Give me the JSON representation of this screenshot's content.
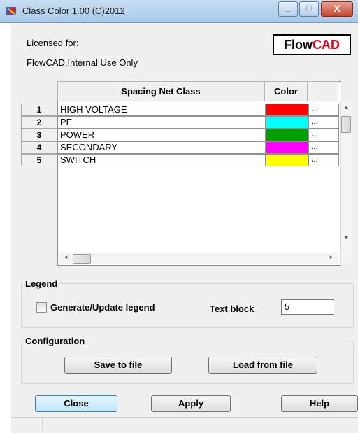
{
  "window": {
    "title": "Class Color 1.00 (C)2012"
  },
  "license": {
    "label": "Licensed for:",
    "holder": "FlowCAD,Internal Use Only"
  },
  "logo": {
    "part1": "Flow",
    "part2": "CAD",
    "color_part2": "#e8001c"
  },
  "grid": {
    "columns": [
      "Spacing Net Class",
      "Color",
      ""
    ],
    "rows": [
      {
        "num": "1",
        "name": "HIGH VOLTAGE",
        "color": "#ff0000",
        "picker": "..."
      },
      {
        "num": "2",
        "name": "PE",
        "color": "#00ffff",
        "picker": "..."
      },
      {
        "num": "3",
        "name": "POWER",
        "color": "#00a000",
        "picker": "..."
      },
      {
        "num": "4",
        "name": "SECONDARY",
        "color": "#ff00ff",
        "picker": "..."
      },
      {
        "num": "5",
        "name": "SWITCH",
        "color": "#ffff00",
        "picker": "..."
      }
    ],
    "scroll_left": "◂",
    "scroll_right": "▸",
    "scroll_up": "▴",
    "scroll_down": "▾"
  },
  "legend": {
    "group_label": "Legend",
    "checkbox_label": "Generate/Update legend",
    "checked": false,
    "text_block_label": "Text block",
    "text_block_value": "5"
  },
  "configuration": {
    "group_label": "Configuration",
    "save_label": "Save to file",
    "load_label": "Load from file"
  },
  "buttons": {
    "close": "Close",
    "apply": "Apply",
    "help": "Help"
  }
}
